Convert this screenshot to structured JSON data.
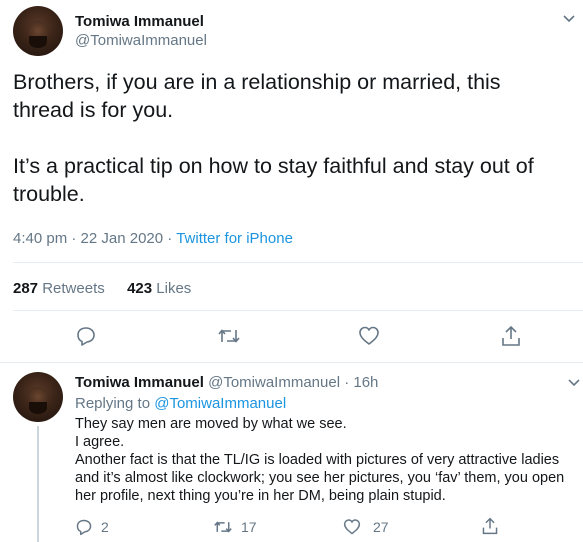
{
  "main_tweet": {
    "author_name": "Tomiwa Immanuel",
    "author_handle": "@TomiwaImmanuel",
    "text_para1_line1": "Brothers, if you are in a relationship or married, this",
    "text_para1_line2": "thread is for you.",
    "text_para2_line1": "It’s a practical tip on how to stay faithful and stay out of",
    "text_para2_line2": "trouble.",
    "time": "4:40 pm",
    "date": "22 Jan 2020",
    "separator": "·",
    "source": "Twitter for iPhone",
    "retweets_count": "287",
    "retweets_label": "Retweets",
    "likes_count": "423",
    "likes_label": "Likes",
    "icons": {
      "chevron": "chevron-down-icon",
      "reply": "reply-icon",
      "retweet": "retweet-icon",
      "like": "heart-icon",
      "share": "share-icon"
    }
  },
  "reply_tweet": {
    "author_name": "Tomiwa Immanuel",
    "author_handle": "@TomiwaImmanuel",
    "separator": "·",
    "time_ago": "16h",
    "replying_to_label": "Replying to",
    "replying_to_handle": "@TomiwaImmanuel",
    "lines": [
      "They say men are moved by what we see.",
      "I agree.",
      "Another fact is that the TL/IG is loaded with pictures of very attractive ladies",
      "and it’s almost like clockwork; you see her pictures, you ‘fav’ them, you open",
      "her profile, next thing you’re in her DM, being plain stupid."
    ],
    "reply_count": "2",
    "retweet_count": "17",
    "like_count": "27"
  },
  "colors": {
    "text": "#14171a",
    "muted": "#657786",
    "link": "#1b95e0",
    "divider": "#e6ecf0",
    "thread_line": "#ccd6dd"
  }
}
